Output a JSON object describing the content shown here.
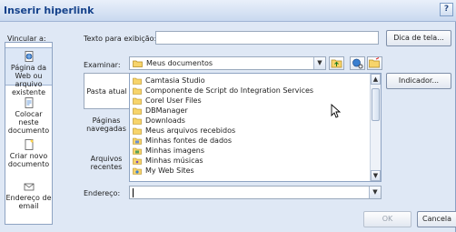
{
  "dialog": {
    "title": "Inserir hiperlink",
    "help": "?"
  },
  "top": {
    "link_to_label": "Vincular a:",
    "display_text_label": "Texto para exibição:",
    "display_text_value": "",
    "screentip_button": "Dica de tela..."
  },
  "nav": [
    {
      "label": "Página da Web ou arquivo existente",
      "icon": "globe-page-icon"
    },
    {
      "label": "Colocar neste documento",
      "icon": "document-place-icon"
    },
    {
      "label": "Criar novo documento",
      "icon": "new-document-icon"
    },
    {
      "label": "Endereço de email",
      "icon": "email-icon"
    }
  ],
  "browse": {
    "look_in_label": "Examinar:",
    "look_in_value": "Meus documentos",
    "bookmark_button": "Indicador..."
  },
  "locations": [
    {
      "label": "Pasta atual"
    },
    {
      "label": "Páginas navegadas"
    },
    {
      "label": "Arquivos recentes"
    }
  ],
  "files": [
    {
      "name": "Camtasia Studio",
      "icon": "folder-icon"
    },
    {
      "name": "Componente de Script do Integration Services",
      "icon": "folder-icon"
    },
    {
      "name": "Corel User Files",
      "icon": "folder-icon"
    },
    {
      "name": "DBManager",
      "icon": "folder-icon"
    },
    {
      "name": "Downloads",
      "icon": "folder-icon"
    },
    {
      "name": "Meus arquivos recebidos",
      "icon": "folder-icon"
    },
    {
      "name": "Minhas fontes de dados",
      "icon": "datasource-folder-icon"
    },
    {
      "name": "Minhas imagens",
      "icon": "pictures-folder-icon"
    },
    {
      "name": "Minhas músicas",
      "icon": "music-folder-icon"
    },
    {
      "name": "My Web Sites",
      "icon": "web-folder-icon"
    }
  ],
  "address": {
    "label": "Endereço:",
    "value": ""
  },
  "footer": {
    "ok": "OK",
    "cancel": "Cancela"
  }
}
